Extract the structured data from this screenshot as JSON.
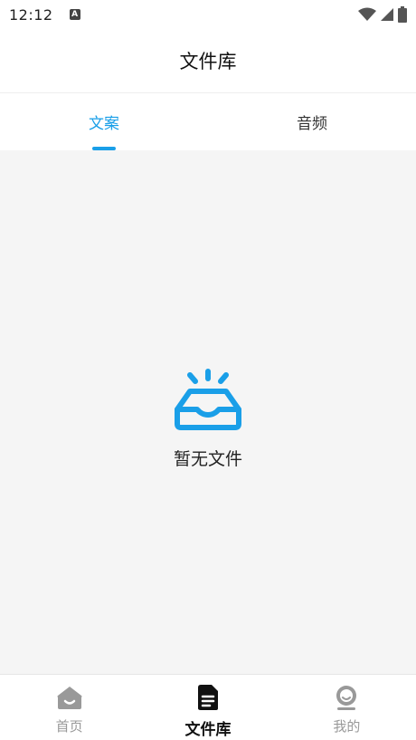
{
  "status_bar": {
    "time": "12:12",
    "notification_glyph": "A"
  },
  "header": {
    "title": "文件库"
  },
  "tabs": [
    {
      "label": "文案",
      "active": true
    },
    {
      "label": "音频",
      "active": false
    }
  ],
  "empty_state": {
    "icon": "inbox-icon",
    "message": "暂无文件"
  },
  "bottom_nav": [
    {
      "label": "首页",
      "icon": "home-icon",
      "active": false
    },
    {
      "label": "文件库",
      "icon": "document-icon",
      "active": true
    },
    {
      "label": "我的",
      "icon": "profile-icon",
      "active": false
    }
  ],
  "colors": {
    "accent": "#1a9fe8",
    "background": "#f5f5f5",
    "inactive_nav": "#999999"
  }
}
